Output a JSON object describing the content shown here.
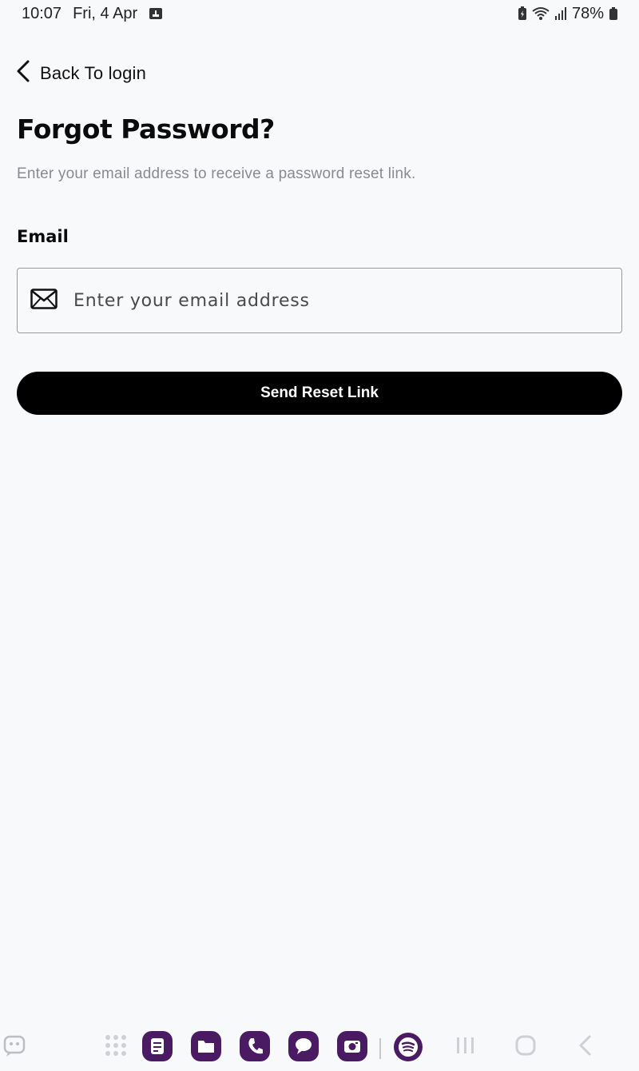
{
  "status_bar": {
    "time": "10:07",
    "date": "Fri, 4 Apr",
    "battery": "78%",
    "icons": [
      "screenshot-icon",
      "battery-saver-icon",
      "wifi-icon",
      "signal-icon",
      "battery-icon"
    ]
  },
  "nav": {
    "back_label": "Back To login"
  },
  "page": {
    "title": "Forgot Password?",
    "subtitle": "Enter your email address to receive a password reset link."
  },
  "form": {
    "email_label": "Email",
    "email_placeholder": "Enter your email address",
    "email_value": "",
    "submit_label": "Send Reset Link"
  },
  "taskbar": {
    "apps": [
      "notes-app-icon",
      "files-app-icon",
      "phone-app-icon",
      "messages-app-icon",
      "camera-app-icon",
      "spotify-app-icon"
    ],
    "system": [
      "app-drawer-icon",
      "recents-icon",
      "home-icon",
      "back-icon"
    ],
    "accent": "#4a1b63"
  }
}
